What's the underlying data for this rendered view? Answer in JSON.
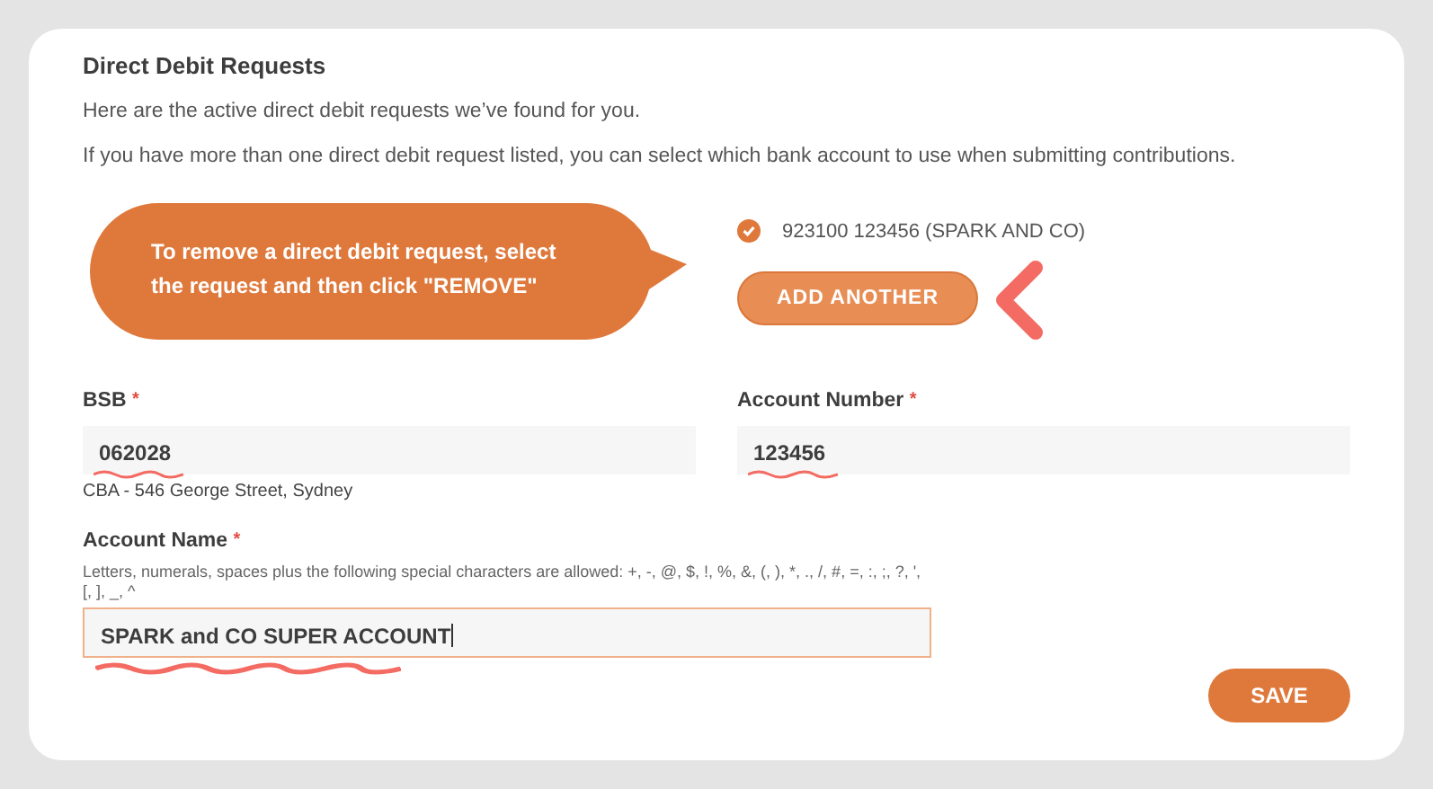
{
  "section": {
    "title": "Direct Debit Requests",
    "intro": "Here are the active direct debit requests we’ve found for you.",
    "note": "If you have more than one direct debit request listed, you can select which bank account to use when submitting contributions."
  },
  "callout": {
    "text": "To remove a direct debit request, select the request and then click \"REMOVE\""
  },
  "requests": [
    {
      "label": "923100 123456 (SPARK AND CO)",
      "checked": true
    }
  ],
  "add_button": "ADD ANOTHER",
  "fields": {
    "bsb": {
      "label": "BSB",
      "required_mark": "*",
      "value": "062028",
      "hint": "CBA - 546 George Street, Sydney"
    },
    "account_number": {
      "label": "Account Number",
      "required_mark": "*",
      "value": "123456"
    },
    "account_name": {
      "label": "Account Name",
      "required_mark": "*",
      "help": "Letters, numerals, spaces plus the following special characters are allowed: +, -, @, $, !, %, &, (, ), *, ., /, #, =, :, ;, ?, ', [, ], _, ^",
      "value": "SPARK and CO SUPER ACCOUNT",
      "focused": true
    }
  },
  "save_button": "SAVE"
}
